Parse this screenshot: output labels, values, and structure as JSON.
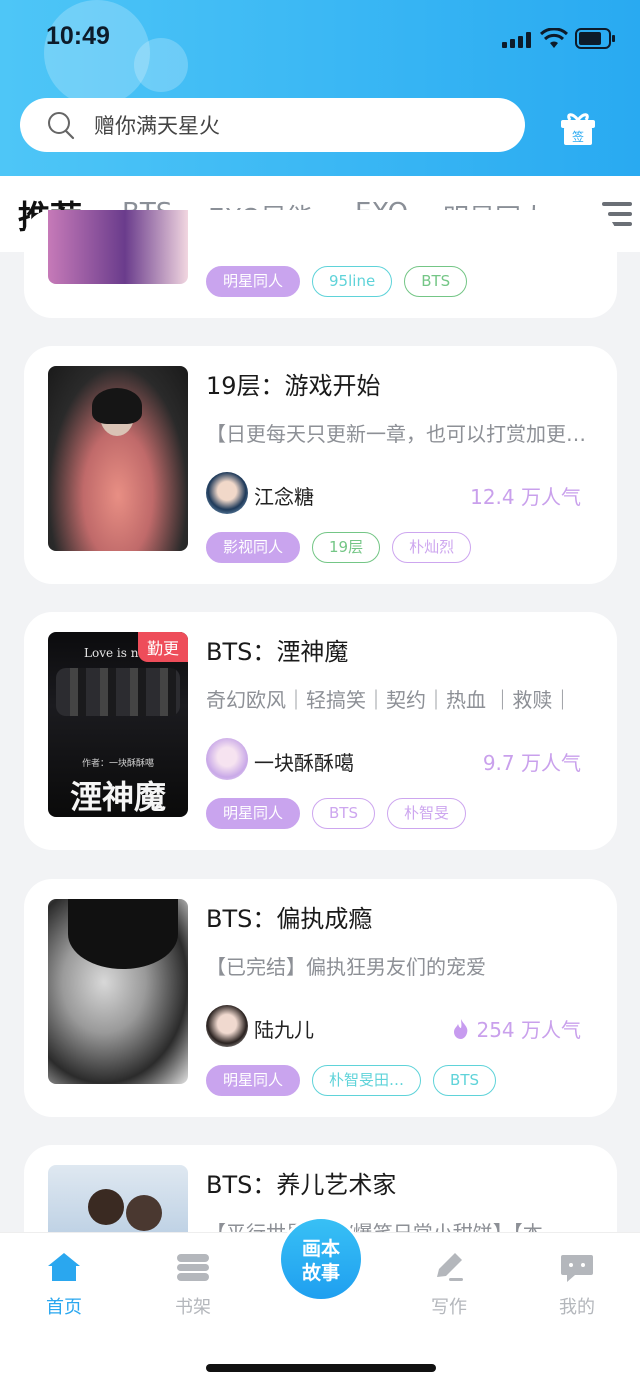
{
  "status": {
    "time": "10:49"
  },
  "search": {
    "placeholder": "赠你满天星火"
  },
  "header": {
    "gift_label": "签"
  },
  "tabs": [
    {
      "label": "推荐",
      "active": true
    },
    {
      "label": "BTS"
    },
    {
      "label": "EXO异能"
    },
    {
      "label": "EXO"
    },
    {
      "label": "明星同人"
    }
  ],
  "partial_card": {
    "tags": [
      "明星同人",
      "95line",
      "BTS"
    ]
  },
  "books": [
    {
      "title": "19层：游戏开始",
      "desc": "【日更每天只更新一章，也可以打赏加更…",
      "author": "江念糖",
      "popularity": "12.4 万人气",
      "tags": [
        "影视同人",
        "19层",
        "朴灿烈"
      ]
    },
    {
      "title": "BTS：湮神魔",
      "desc": "奇幻欧风｜轻搞笑｜契约｜热血 ｜救赎｜",
      "author": "一块酥酥噶",
      "popularity": "9.7 万人气",
      "badge": "勤更",
      "cover_text": "Love is not",
      "cover_author": "作者：一块酥酥噶",
      "cover_title": "湮神魔",
      "tags": [
        "明星同人",
        "BTS",
        "朴智旻"
      ]
    },
    {
      "title": "BTS：偏执成瘾",
      "desc": "【已完结】偏执狂男友们的宠爱",
      "author": "陆九儿",
      "popularity": "254 万人气",
      "tags": [
        "明星同人",
        "朴智旻田…",
        "BTS"
      ]
    },
    {
      "title": "BTS：养儿艺术家",
      "desc": "【平行世界…子/爆笑日常小甜饼】【本"
    }
  ],
  "bottom_nav": [
    {
      "label": "首页",
      "active": true
    },
    {
      "label": "书架"
    },
    {
      "center": "画本故事"
    },
    {
      "label": "写作"
    },
    {
      "label": "我的"
    }
  ],
  "colors": {
    "accent": "#2aa7ef",
    "tag_purple": "#c9a4ee",
    "popularity": "#c9a0ec",
    "badge": "#ee4d5a"
  }
}
